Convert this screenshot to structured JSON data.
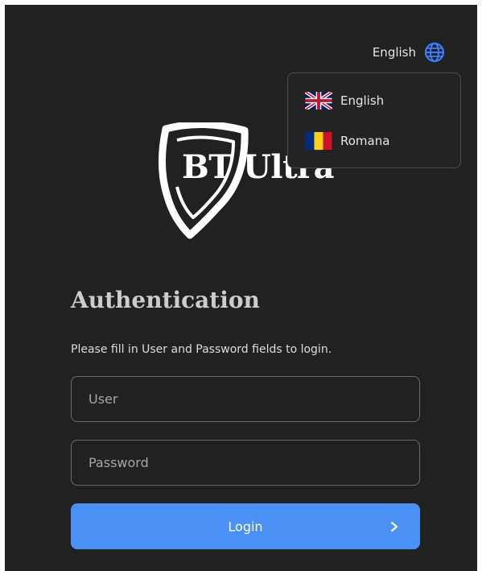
{
  "language_selector": {
    "current": "English",
    "icon": "globe-icon",
    "options": [
      {
        "label": "English",
        "flag": "uk-flag-icon"
      },
      {
        "label": "Romana",
        "flag": "romania-flag-icon"
      }
    ]
  },
  "logo": {
    "text": "BT Ultra",
    "icon": "shield-icon"
  },
  "auth": {
    "title": "Authentication",
    "description": "Please fill in User and Password fields to login.",
    "user_placeholder": "User",
    "password_placeholder": "Password",
    "login_label": "Login",
    "login_icon": "chevron-right-icon"
  },
  "colors": {
    "background": "#212121",
    "accent": "#4a90f5",
    "globe": "#3b7cff"
  }
}
